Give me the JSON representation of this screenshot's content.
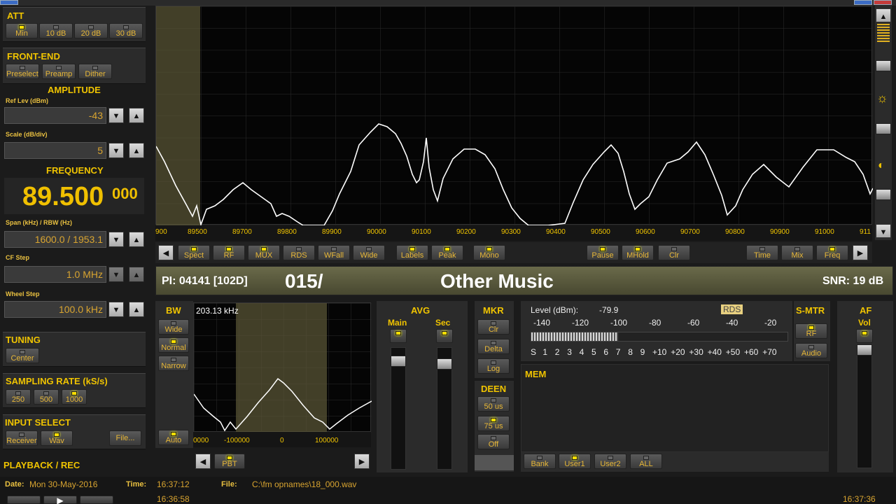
{
  "att": {
    "title": "ATT",
    "buttons": [
      "Min",
      "10 dB",
      "20 dB",
      "30 dB"
    ]
  },
  "frontend": {
    "title": "FRONT-END",
    "buttons": [
      "Preselector",
      "Preamp",
      "Dither"
    ]
  },
  "amplitude": {
    "title": "AMPLITUDE",
    "ref_label": "Ref Lev (dBm)",
    "ref_value": "-43",
    "scale_label": "Scale (dB/div)",
    "scale_value": "5"
  },
  "frequency": {
    "title": "FREQUENCY",
    "main": "89.500",
    "fine": "000",
    "span_label": "Span (kHz) / RBW (Hz)",
    "span_value": "1600.0 / 1953.1",
    "cf_label": "CF Step",
    "cf_value": "1.0 MHz",
    "wheel_label": "Wheel Step",
    "wheel_value": "100.0 kHz"
  },
  "tuning": {
    "title": "TUNING",
    "button": "Center"
  },
  "sampling": {
    "title": "SAMPLING RATE (kS/s)",
    "buttons": [
      "250",
      "500",
      "1000"
    ]
  },
  "input": {
    "title": "INPUT SELECT",
    "buttons": [
      "Receiver",
      "Wav",
      "File..."
    ]
  },
  "playback": {
    "title": "PLAYBACK / REC"
  },
  "status": {
    "date_label": "Date:",
    "date": "Mon 30-May-2016",
    "time_label": "Time:",
    "time": "16:37:12",
    "file_label": "File:",
    "file": "C:\\fm opnames\\18_000.wav",
    "time_start": "16:36:58",
    "time_end": "16:37:36"
  },
  "spectrum": {
    "xticks": [
      "900",
      "89500",
      "89700",
      "89800",
      "89900",
      "90000",
      "90100",
      "90200",
      "90300",
      "90400",
      "90500",
      "90600",
      "90700",
      "90800",
      "90900",
      "91000",
      "911"
    ]
  },
  "spectrum_buttons": {
    "left": [
      "Spect",
      "RF",
      "MUX",
      "RDS",
      "WFall",
      "Wide",
      "Labels",
      "Peak",
      "Mono"
    ],
    "right": [
      "Pause",
      "MHold",
      "Clr"
    ],
    "far": [
      "Time",
      "Mix",
      "Freq"
    ]
  },
  "rds": {
    "pi": "PI: 04141 [102D]",
    "ps": "015/",
    "pty": "Other Music",
    "snr": "SNR: 19 dB"
  },
  "bw": {
    "title": "BW",
    "value": "203.13 kHz",
    "buttons": [
      "Wide",
      "Normal",
      "Narrow"
    ],
    "auto": "Auto",
    "pbt": "PBT",
    "xticks": [
      "0000",
      "-100000",
      "0",
      "100000"
    ]
  },
  "avg": {
    "title": "AVG",
    "main": "Main",
    "sec": "Sec"
  },
  "mkr": {
    "title": "MKR",
    "buttons": [
      "Clr",
      "Delta",
      "Log"
    ]
  },
  "deen": {
    "title": "DEEN",
    "buttons": [
      "50 us",
      "75 us",
      "Off"
    ]
  },
  "level": {
    "label": "Level (dBm):",
    "value": "-79.9",
    "rds_badge": "RDS",
    "scale": [
      "-140",
      "-120",
      "-100",
      "-80",
      "-60",
      "-40",
      "-20"
    ],
    "units": [
      "S",
      "1",
      "2",
      "3",
      "4",
      "5",
      "6",
      "7",
      "8",
      "9",
      "+10",
      "+20",
      "+30",
      "+40",
      "+50",
      "+60",
      "+70"
    ],
    "meter_fraction": 0.34
  },
  "smtr": {
    "title": "S-MTR",
    "buttons": [
      "RF",
      "Audio"
    ]
  },
  "af": {
    "title": "AF",
    "vol": "Vol"
  },
  "mem": {
    "title": "MEM",
    "buttons": [
      "Bank",
      "User1",
      "User2",
      "ALL"
    ]
  }
}
